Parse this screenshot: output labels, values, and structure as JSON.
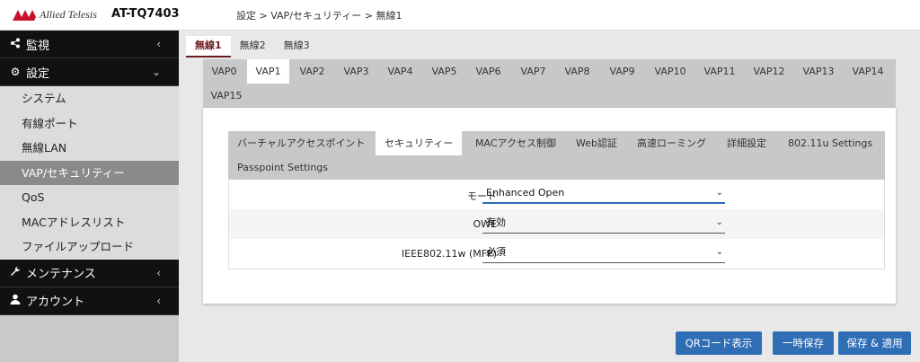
{
  "header": {
    "brand": "Allied Telesis",
    "model": "AT-TQ7403",
    "breadcrumb": "設定 > VAP/セキュリティー > 無線1"
  },
  "sidebar": {
    "sections": [
      {
        "label": "監視",
        "icon": "share-icon"
      },
      {
        "label": "設定",
        "icon": "gear-icon"
      }
    ],
    "settings_items": [
      {
        "label": "システム"
      },
      {
        "label": "有線ポート"
      },
      {
        "label": "無線LAN"
      },
      {
        "label": "VAP/セキュリティー",
        "active": true
      },
      {
        "label": "QoS"
      },
      {
        "label": "MACアドレスリスト"
      },
      {
        "label": "ファイルアップロード"
      }
    ],
    "bottom_sections": [
      {
        "label": "メンテナンス",
        "icon": "wrench-icon"
      },
      {
        "label": "アカウント",
        "icon": "user-icon"
      }
    ]
  },
  "radio_tabs": [
    "無線1",
    "無線2",
    "無線3"
  ],
  "vap_tabs": [
    "VAP0",
    "VAP1",
    "VAP2",
    "VAP3",
    "VAP4",
    "VAP5",
    "VAP6",
    "VAP7",
    "VAP8",
    "VAP9",
    "VAP10",
    "VAP11",
    "VAP12",
    "VAP13",
    "VAP14",
    "VAP15"
  ],
  "sub_tabs": [
    "バーチャルアクセスポイント",
    "セキュリティー",
    "MACアクセス制御",
    "Web認証",
    "高速ローミング",
    "詳細設定",
    "802.11u Settings",
    "Passpoint Settings"
  ],
  "form": {
    "mode_label": "モード",
    "mode_value": "Enhanced Open",
    "owe_label": "OWE",
    "owe_value": "有効",
    "mfp_label": "IEEE802.11w (MFP)",
    "mfp_value": "必須"
  },
  "buttons": {
    "qr": "QRコード表示",
    "temp_save": "一時保存",
    "save_apply": "保存 & 適用"
  },
  "colors": {
    "accent": "#2f6db5",
    "active_radio": "#6b1a20"
  }
}
